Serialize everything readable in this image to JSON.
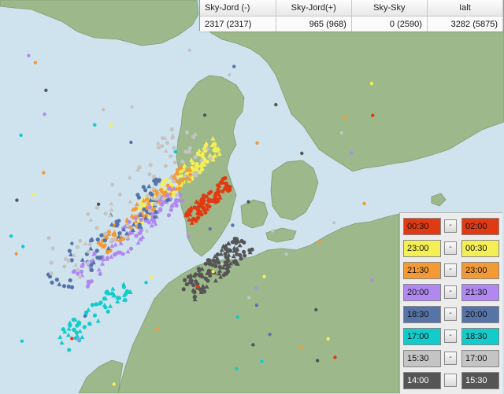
{
  "stats": {
    "headers": [
      "Sky-Jord (-)",
      "Sky-Jord(+)",
      "Sky-Sky",
      "Ialt"
    ],
    "values": [
      "2317 (2317)",
      "965 (968)",
      "0 (2590)",
      "3282 (5875)"
    ]
  },
  "legend": [
    {
      "start": "00:30",
      "end": "02:00",
      "button": "-",
      "color": "#e03a12"
    },
    {
      "start": "23:00",
      "end": "00:30",
      "button": "-",
      "color": "#f5ef56"
    },
    {
      "start": "21:30",
      "end": "23:00",
      "button": "-",
      "color": "#f39a35"
    },
    {
      "start": "20:00",
      "end": "21:30",
      "button": "-",
      "color": "#b088f0"
    },
    {
      "start": "18:30",
      "end": "20:00",
      "button": "-",
      "color": "#5674a8"
    },
    {
      "start": "17:00",
      "end": "18:30",
      "button": "-",
      "color": "#12cccc"
    },
    {
      "start": "15:30",
      "end": "17:00",
      "button": "-",
      "color": "#c4c4c4"
    },
    {
      "start": "14:00",
      "end": "15:30",
      "button": "",
      "color": "#555555"
    }
  ],
  "colors": {
    "sea": "#cfe3ee",
    "land": "#9db98b",
    "land_border": "#7f9c70"
  }
}
